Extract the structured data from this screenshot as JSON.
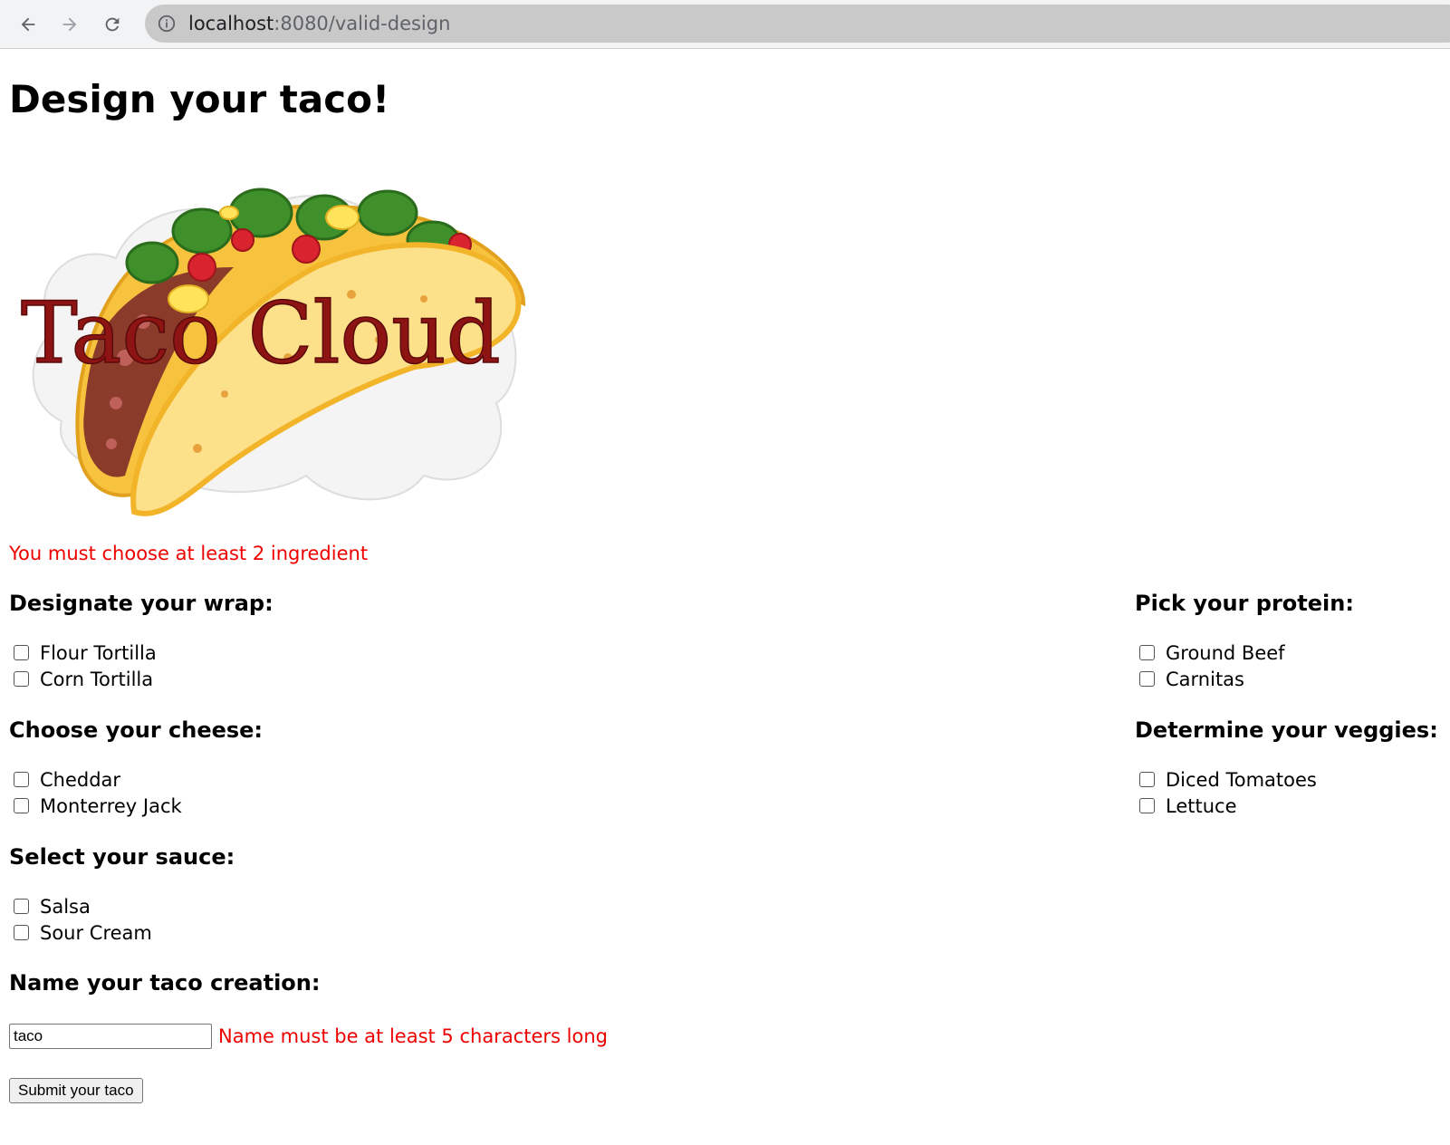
{
  "browser": {
    "url_host": "localhost",
    "url_rest": ":8080/valid-design",
    "back_icon": "arrow-left-icon",
    "forward_icon": "arrow-right-icon",
    "reload_icon": "reload-icon",
    "info_icon": "info-icon"
  },
  "page": {
    "title": "Design your taco!",
    "logo_text": "Taco Cloud",
    "error_ingredients": "You must choose at least 2 ingredient"
  },
  "groups": {
    "wrap": {
      "heading": "Designate your wrap:",
      "options": [
        "Flour Tortilla",
        "Corn Tortilla"
      ]
    },
    "protein": {
      "heading": "Pick your protein:",
      "options": [
        "Ground Beef",
        "Carnitas"
      ]
    },
    "cheese": {
      "heading": "Choose your cheese:",
      "options": [
        "Cheddar",
        "Monterrey Jack"
      ]
    },
    "veggies": {
      "heading": "Determine your veggies:",
      "options": [
        "Diced Tomatoes",
        "Lettuce"
      ]
    },
    "sauce": {
      "heading": "Select your sauce:",
      "options": [
        "Salsa",
        "Sour Cream"
      ]
    }
  },
  "name_section": {
    "heading": "Name your taco creation:",
    "value": "taco",
    "error": "Name must be at least 5 characters long"
  },
  "submit_label": "Submit your taco",
  "colors": {
    "error": "#ee0000",
    "omnibox": "#c9c9c9"
  }
}
